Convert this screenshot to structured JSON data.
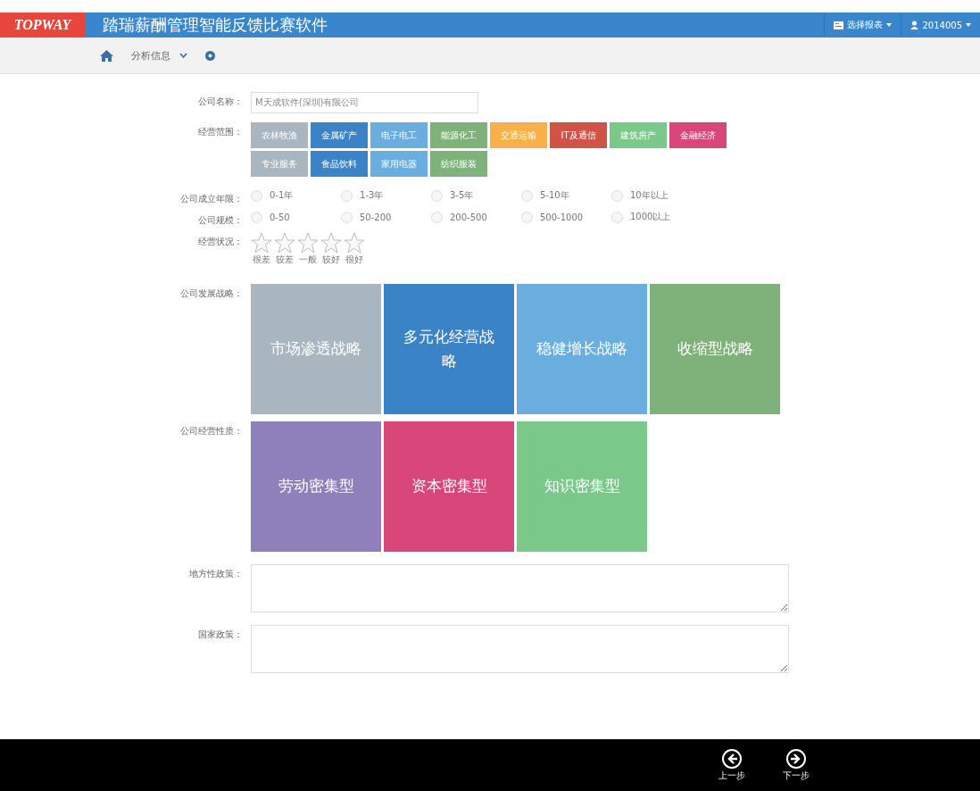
{
  "header": {
    "logo": "TOPWAY",
    "title": "踏瑞薪酬管理智能反馈比赛软件",
    "menus": [
      {
        "kind": "report",
        "label": "选择报表"
      },
      {
        "kind": "user",
        "label": "2014005"
      }
    ]
  },
  "nav": {
    "label": "分析信息"
  },
  "form": {
    "company_name": {
      "label": "公司名称：",
      "value": "M天成软件(深圳)有限公司"
    },
    "scope": {
      "label": "经营范围：",
      "tags": [
        {
          "label": "农林牧渔",
          "color": "#a9b6c0"
        },
        {
          "label": "金属矿产",
          "color": "#3a83c6"
        },
        {
          "label": "电子电工",
          "color": "#6aaee0"
        },
        {
          "label": "能源化工",
          "color": "#7fb27a"
        },
        {
          "label": "交通运输",
          "color": "#f8b04a"
        },
        {
          "label": "IT及通信",
          "color": "#cf5346"
        },
        {
          "label": "建筑房产",
          "color": "#7ac98b"
        },
        {
          "label": "金融经济",
          "color": "#d9467a"
        },
        {
          "label": "专业服务",
          "color": "#a9b6c0"
        },
        {
          "label": "食品饮料",
          "color": "#3a83c6"
        },
        {
          "label": "家用电器",
          "color": "#6aaee0"
        },
        {
          "label": "纺织服装",
          "color": "#7fb27a"
        }
      ]
    },
    "age": {
      "label": "公司成立年限：",
      "options": [
        {
          "label": "0-1年",
          "selected": false
        },
        {
          "label": "1-3年",
          "selected": false
        },
        {
          "label": "3-5年",
          "selected": false
        },
        {
          "label": "5-10年",
          "selected": false
        },
        {
          "label": "10年以上",
          "selected": false
        }
      ]
    },
    "size": {
      "label": "公司规模：",
      "options": [
        {
          "label": "0-50",
          "selected": false
        },
        {
          "label": "50-200",
          "selected": false
        },
        {
          "label": "200-500",
          "selected": false
        },
        {
          "label": "500-1000",
          "selected": false
        },
        {
          "label": "1000以上",
          "selected": false
        }
      ]
    },
    "status": {
      "label": "经营状况：",
      "stars": 0,
      "star_labels": [
        "很差",
        "较差",
        "一般",
        "较好",
        "很好"
      ]
    },
    "strategy": {
      "label": "公司发展战略：",
      "tiles": [
        {
          "label": "市场渗透战略",
          "color": "#a9b6c0"
        },
        {
          "label": "多元化经营战略",
          "color": "#3a83c6"
        },
        {
          "label": "稳健增长战略",
          "color": "#6aaee0"
        },
        {
          "label": "收缩型战略",
          "color": "#7fb27a"
        }
      ]
    },
    "nature": {
      "label": "公司经营性质：",
      "tiles": [
        {
          "label": "劳动密集型",
          "color": "#8f7fbb"
        },
        {
          "label": "资本密集型",
          "color": "#d9467a"
        },
        {
          "label": "知识密集型",
          "color": "#7ac98b"
        }
      ]
    },
    "local_policy": {
      "label": "地方性政策："
    },
    "national_policy": {
      "label": "国家政策："
    }
  },
  "footer": {
    "buttons": [
      {
        "kind": "prev",
        "label": "上一步"
      },
      {
        "kind": "next",
        "label": "下一步"
      }
    ]
  }
}
